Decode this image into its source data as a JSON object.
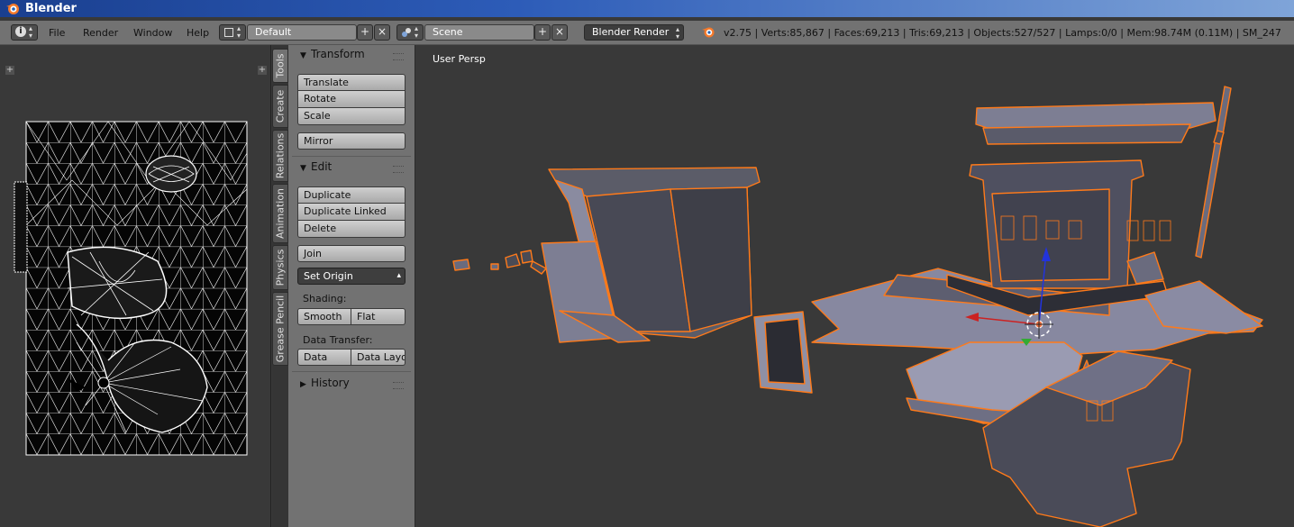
{
  "window": {
    "title": "Blender"
  },
  "header": {
    "menus": [
      "File",
      "Render",
      "Window",
      "Help"
    ],
    "layout_name": "Default",
    "scene_name": "Scene",
    "render_engine": "Blender Render",
    "stats": "v2.75 | Verts:85,867 | Faces:69,213 | Tris:69,213 | Objects:527/527 | Lamps:0/0 | Mem:98.74M (0.11M) | SM_247"
  },
  "tabs": [
    "Tools",
    "Create",
    "Relations",
    "Animation",
    "Physics",
    "Grease Pencil"
  ],
  "toolshelf": {
    "transform": {
      "title": "Transform",
      "buttons": [
        "Translate",
        "Rotate",
        "Scale"
      ],
      "mirror": "Mirror"
    },
    "edit": {
      "title": "Edit",
      "buttons": [
        "Duplicate",
        "Duplicate Linked",
        "Delete"
      ],
      "join": "Join",
      "set_origin": "Set Origin",
      "shading_label": "Shading:",
      "smooth": "Smooth",
      "flat": "Flat",
      "data_transfer_label": "Data Transfer:",
      "data": "Data",
      "data_layout": "Data Layo"
    },
    "history": {
      "title": "History"
    }
  },
  "viewport": {
    "label": "User Persp"
  },
  "colors": {
    "selection_outline": "#ff7a1a",
    "model_fill": "#7d7d90",
    "model_dark": "#4a4b55",
    "axis_x": "#cc2222",
    "axis_z": "#2233dd",
    "axis_y": "#33aa33"
  }
}
